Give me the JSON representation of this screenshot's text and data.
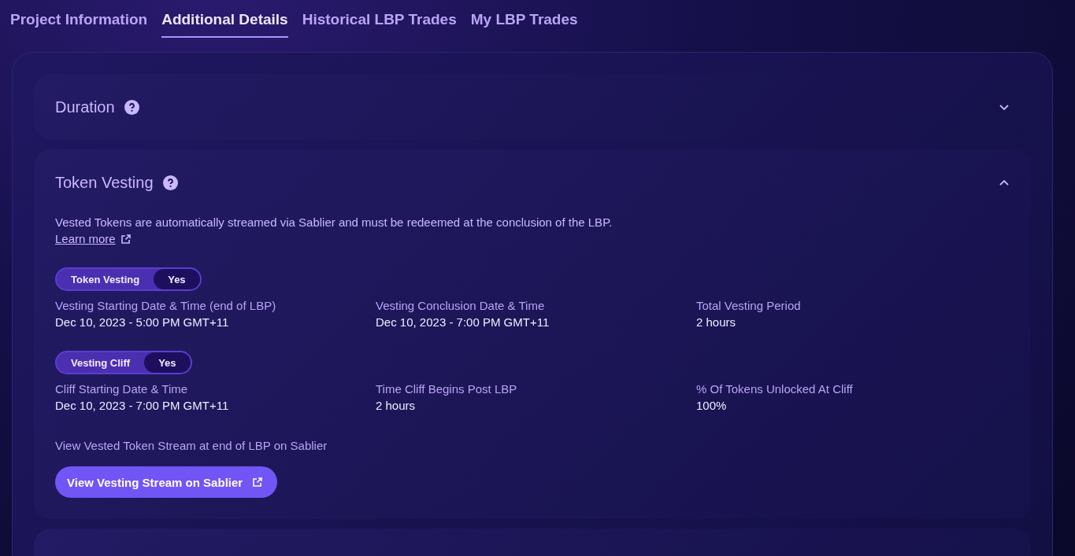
{
  "tabs": [
    {
      "label": "Project Information",
      "selected": false
    },
    {
      "label": "Additional Details",
      "selected": true
    },
    {
      "label": "Historical LBP Trades",
      "selected": false
    },
    {
      "label": "My LBP Trades",
      "selected": false
    }
  ],
  "sections": [
    {
      "title": "Duration",
      "expanded": false
    },
    {
      "title": "Token Vesting",
      "expanded": true,
      "description": "Vested Tokens are automatically streamed via Sablier and must be redeemed at the conclusion of the LBP.",
      "link": "Learn more",
      "groups": [
        {
          "toggle_label": "Token Vesting",
          "toggle_value": "Yes",
          "fields": [
            {
              "label": "Vesting Starting Date & Time (end of LBP)",
              "value": "Dec 10, 2023 - 5:00 PM GMT+11"
            },
            {
              "label": "Vesting Conclusion Date & Time",
              "value": "Dec 10, 2023 - 7:00 PM GMT+11"
            },
            {
              "label": "Total Vesting Period",
              "value": "2 hours"
            }
          ]
        },
        {
          "toggle_label": "Vesting Cliff",
          "toggle_value": "Yes",
          "fields": [
            {
              "label": "Cliff Starting Date & Time",
              "value": "Dec 10, 2023 - 7:00 PM GMT+11"
            },
            {
              "label": "Time Cliff Begins Post LBP",
              "value": "2 hours"
            },
            {
              "label": "% Of Tokens Unlocked At Cliff",
              "value": "100%"
            }
          ]
        }
      ],
      "stream_note": "View Vested Token Stream at end of LBP on Sablier",
      "button": "View Vesting Stream on Sablier"
    }
  ]
}
